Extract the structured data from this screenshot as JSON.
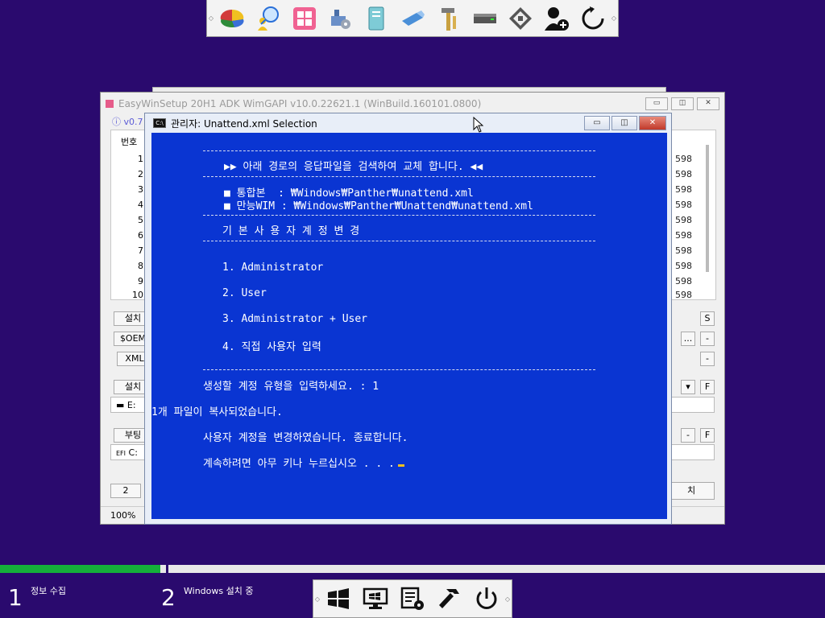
{
  "top_toolbar": {
    "icons": [
      "disk-partition-icon",
      "search-user-icon",
      "windows-tiles-icon",
      "system-tools-icon",
      "document-icon",
      "usb-drive-icon",
      "tools-icon",
      "drive-icon",
      "floppy-disk-icon",
      "add-user-icon",
      "refresh-icon"
    ]
  },
  "back_window": {
    "title": "EasyWinSetup   20H1 ADK   WimGAPI v10.0.22621.1 (WinBuild.160101.0800)",
    "version": "ⓘ v0.7",
    "list_header": "번호",
    "rows": [
      "1",
      "2",
      "3",
      "4",
      "5",
      "6",
      "7",
      "8",
      "9",
      "10"
    ],
    "right_values": [
      "598",
      "598",
      "598",
      "598",
      "598",
      "598",
      "598",
      "598",
      "598",
      "598"
    ],
    "buttons": {
      "install": "설치",
      "oem": "$OEM",
      "xml": "XML",
      "install2": "설치",
      "boot": "부팅",
      "s": "S",
      "dots": "...",
      "minus": "-",
      "f": "F",
      "two": "2",
      "finish": "치"
    },
    "fields": {
      "e_drive": "▬ E:",
      "c_drive": "C:",
      "efi_label": "EFI"
    },
    "status_zoom": "100%"
  },
  "console": {
    "title": "관리자:  Unattend.xml Selection",
    "heading": "▶▶ 아래 경로의 응답파일을 검색하여 교체 합니다. ◀◀",
    "path1": "■ 통합본  : ₩Windows₩Panther₩unattend.xml",
    "path2": "■ 만능WIM : ₩Windows₩Panther₩Unattend₩unattend.xml",
    "section": "기 본 사 용 자 계 정 변 경",
    "options": [
      "1. Administrator",
      "2. User",
      "3. Administrator + User",
      "4. 직접 사용자 입력"
    ],
    "prompt": "생성할 계정 유형을 입력하세요. : 1",
    "copied": "1개 파일이 복사되었습니다.",
    "done": "사용자 계정을 변경하였습니다. 종료합니다.",
    "continue": "계속하려면 아무 키나 누르십시오 . . ."
  },
  "progress": {
    "step1_fraction": 1.0
  },
  "steps": [
    {
      "number": "1",
      "label": "정보 수집"
    },
    {
      "number": "2",
      "label": "Windows 설치 중"
    }
  ],
  "bottom_toolbar": {
    "icons": [
      "windows-logo-icon",
      "monitor-icon",
      "task-list-icon",
      "hammer-icon",
      "power-icon"
    ]
  },
  "colors": {
    "desktop": "#2a0a6e",
    "console_bg": "#0a35d2",
    "progress": "#15b03a"
  }
}
